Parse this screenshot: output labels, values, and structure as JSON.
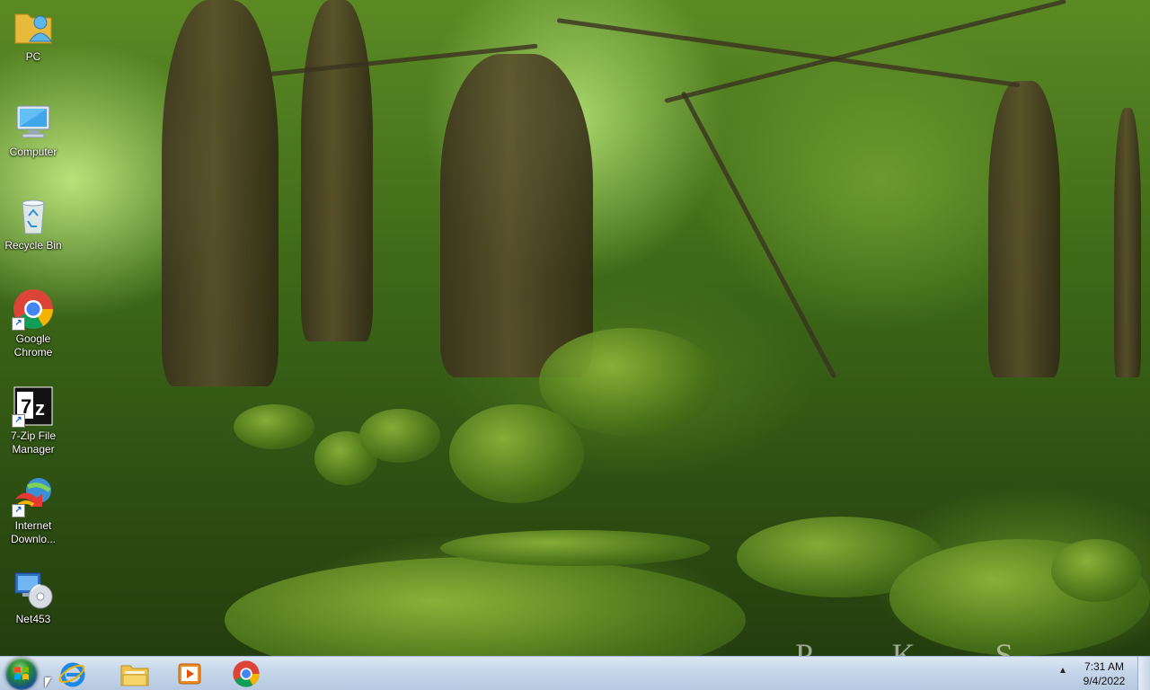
{
  "wallpaper": {
    "watermark": "P K S"
  },
  "desktop": {
    "icons": [
      {
        "label": "PC",
        "icon": "user-folder-icon"
      },
      {
        "label": "Computer",
        "icon": "computer-icon"
      },
      {
        "label": "Recycle Bin",
        "icon": "recycle-bin-icon"
      },
      {
        "label": "Google Chrome",
        "icon": "chrome-icon",
        "shortcut": true
      },
      {
        "label": "7-Zip File Manager",
        "icon": "seven-zip-icon",
        "shortcut": true
      },
      {
        "label": "Internet Downlo...",
        "icon": "internet-download-manager-icon",
        "shortcut": true
      },
      {
        "label": "Net453",
        "icon": "net-installer-icon"
      }
    ]
  },
  "taskbar": {
    "pinned": [
      {
        "name": "internet-explorer",
        "icon": "internet-explorer-icon"
      },
      {
        "name": "file-explorer",
        "icon": "folder-icon"
      },
      {
        "name": "media-player",
        "icon": "media-player-icon"
      },
      {
        "name": "chrome",
        "icon": "chrome-icon"
      }
    ],
    "clock": {
      "time": "7:31 AM",
      "date": "9/4/2022"
    },
    "colors": {
      "taskbar": "#c5d6ea",
      "accent": "#1d5fc4"
    }
  }
}
